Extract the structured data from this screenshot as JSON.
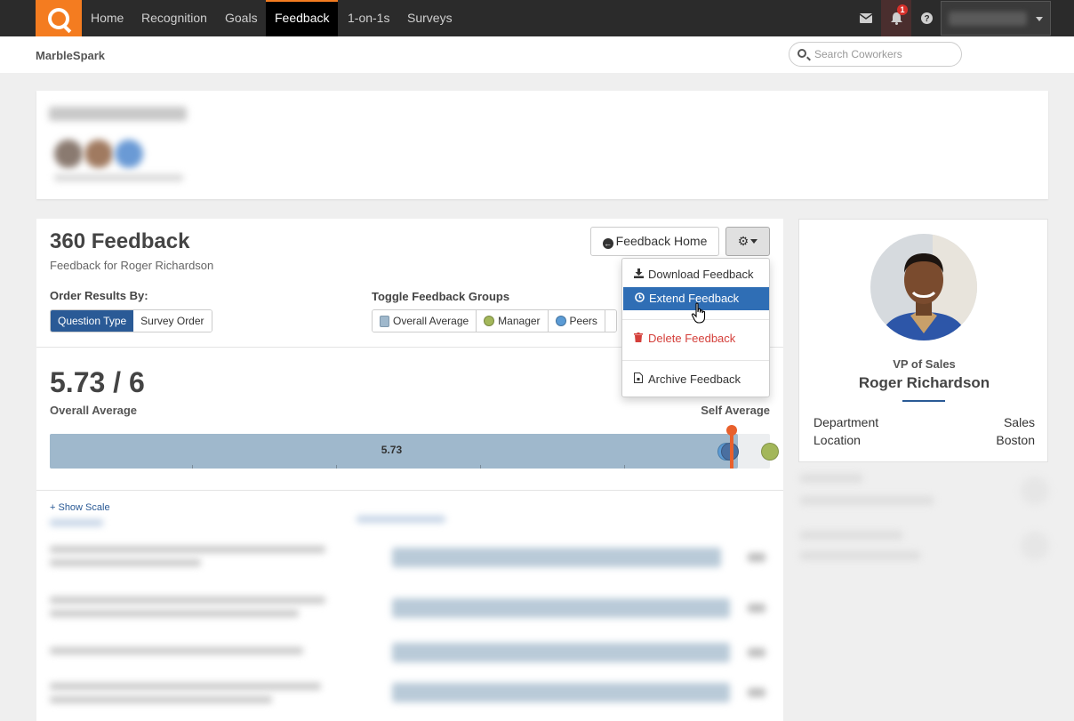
{
  "nav": {
    "items": [
      "Home",
      "Recognition",
      "Goals",
      "Feedback",
      "1-on-1s",
      "Surveys"
    ],
    "active": "Feedback",
    "notification_count": "1",
    "accent": "#f47c20"
  },
  "subbar": {
    "org_name": "MarbleSpark",
    "search_placeholder": "Search Coworkers"
  },
  "feedback": {
    "title": "360 Feedback",
    "subtitle": "Feedback for Roger Richardson",
    "home_button": "Feedback Home",
    "order_label": "Order Results By:",
    "order_options": [
      "Question Type",
      "Survey Order"
    ],
    "order_selected": "Question Type",
    "toggle_label": "Toggle Feedback Groups",
    "groups": [
      {
        "label": "Overall Average",
        "color": "#9fb8cc"
      },
      {
        "label": "Manager",
        "color": "#a3b75a"
      },
      {
        "label": "Peers",
        "color": "#5b9bd5"
      }
    ],
    "score": "5.73 / 6",
    "overall_label": "Overall Average",
    "self_label": "Self Average",
    "bar_value": 5.73,
    "bar_value_label": "5.73",
    "bar_max": 6,
    "markers": {
      "peers": 5.64,
      "group2": 5.67,
      "manager": 6.0,
      "self": 5.68
    },
    "show_scale": "+ Show Scale"
  },
  "menu": {
    "items": [
      {
        "label": "Download Feedback",
        "icon": "download-icon"
      },
      {
        "label": "Extend Feedback",
        "icon": "clock-icon",
        "highlighted": true
      },
      {
        "label": "Delete Feedback",
        "icon": "trash-icon",
        "danger": true
      },
      {
        "label": "Archive Feedback",
        "icon": "archive-icon"
      }
    ]
  },
  "profile": {
    "role": "VP of Sales",
    "name": "Roger Richardson",
    "department_label": "Department",
    "department": "Sales",
    "location_label": "Location",
    "location": "Boston"
  }
}
